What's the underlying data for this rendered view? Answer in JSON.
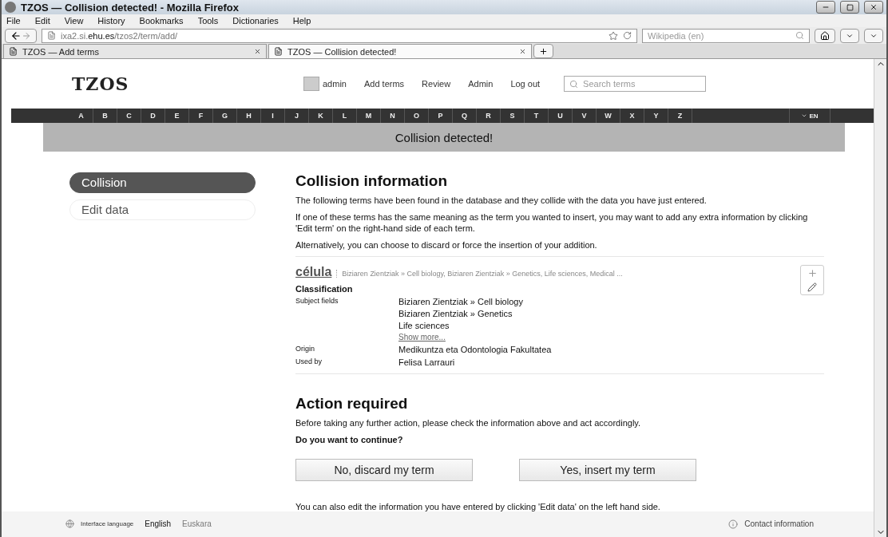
{
  "window": {
    "title": "TZOS — Collision detected! - Mozilla Firefox"
  },
  "menu": [
    "File",
    "Edit",
    "View",
    "History",
    "Bookmarks",
    "Tools",
    "Dictionaries",
    "Help"
  ],
  "nav": {
    "url": "ixa2.si.**ehu.es**/tzos2/term/add/",
    "search_placeholder": "Wikipedia (en)"
  },
  "tabs": [
    {
      "label": "TZOS — Add terms",
      "selected": false
    },
    {
      "label": "TZOS — Collision detected!",
      "selected": true
    }
  ],
  "site": {
    "logo": "TZOS",
    "user": "admin",
    "links": [
      "Add terms",
      "Review",
      "Admin",
      "Log out"
    ],
    "search_placeholder": "Search terms",
    "letters": [
      "A",
      "B",
      "C",
      "D",
      "E",
      "F",
      "G",
      "H",
      "I",
      "J",
      "K",
      "L",
      "M",
      "N",
      "O",
      "P",
      "Q",
      "R",
      "S",
      "T",
      "U",
      "V",
      "W",
      "X",
      "Y",
      "Z"
    ],
    "language": "EN"
  },
  "banner": "Collision detected!",
  "sidebar": [
    {
      "label": "Collision",
      "selected": true
    },
    {
      "label": "Edit data",
      "selected": false
    }
  ],
  "collision": {
    "heading": "Collision information",
    "paragraphs": [
      "The following terms have been found in the database and they collide with the data you have just entered.",
      "If one of these terms has the same meaning as the term you wanted to insert, you may want to add any extra information by clicking 'Edit term' on the right-hand side of each term.",
      "Alternatively, you can choose to discard or force the insertion of your addition."
    ],
    "term": {
      "name": "célula",
      "summary": "Biziaren Zientziak » Cell biology, Biziaren Zientziak » Genetics, Life sciences, Medical ...",
      "section": "Classification",
      "rows": [
        {
          "label": "Subject fields",
          "values": [
            "Biziaren Zientziak » Cell biology",
            "Biziaren Zientziak » Genetics",
            "Life sciences"
          ],
          "more": "Show more..."
        },
        {
          "label": "Origin",
          "values": [
            "Medikuntza eta Odontologia Fakultatea"
          ]
        },
        {
          "label": "Used by",
          "values": [
            "Felisa Larrauri"
          ]
        }
      ]
    }
  },
  "action": {
    "heading": "Action required",
    "text": "Before taking any further action, please check the information above and act accordingly.",
    "question": "Do you want to continue?",
    "buttons": [
      "No, discard my term",
      "Yes, insert my term"
    ],
    "note": "You can also edit the information you have entered by clicking 'Edit data' on the left hand side."
  },
  "footer": {
    "language_label": "Interface language",
    "languages": [
      {
        "label": "English",
        "selected": true
      },
      {
        "label": "Euskara",
        "selected": false
      }
    ],
    "contact": "Contact information"
  }
}
